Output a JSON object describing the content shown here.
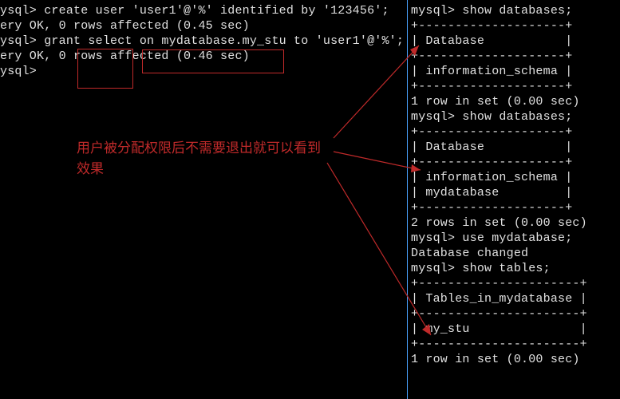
{
  "left": {
    "l1": "ysql> create user 'user1'@'%' identified by '123456';",
    "l2": "ery OK, 0 rows affected (0.45 sec)",
    "l3": "",
    "l4": "ysql> grant select on mydatabase.my_stu to 'user1'@'%';",
    "l5": "ery OK, 0 rows affected (0.46 sec)",
    "l6": "",
    "l7": "ysql>"
  },
  "right": {
    "r1": "mysql> show databases;",
    "r2": "+--------------------+",
    "r3": "| Database           |",
    "r4": "+--------------------+",
    "r5": "| information_schema |",
    "r6": "+--------------------+",
    "r7": "1 row in set (0.00 sec)",
    "r8": "",
    "r9": "mysql> show databases;",
    "r10": "+--------------------+",
    "r11": "| Database           |",
    "r12": "+--------------------+",
    "r13": "| information_schema |",
    "r14": "| mydatabase         |",
    "r15": "+--------------------+",
    "r16": "2 rows in set (0.00 sec)",
    "r17": "",
    "r18": "mysql> use mydatabase;",
    "r19": "Database changed",
    "r20": "mysql> show tables;",
    "r21": "+----------------------+",
    "r22": "| Tables_in_mydatabase |",
    "r23": "+----------------------+",
    "r24": "| my_stu               |",
    "r25": "+----------------------+",
    "r26": "1 row in set (0.00 sec)"
  },
  "annotation": "用户被分配权限后不需要退出就可以看到\n效果",
  "colors": {
    "terminal_fg": "#e0e0e0",
    "terminal_bg": "#000000",
    "divider": "#4aa3ff",
    "annotation_red": "#c02a2a"
  }
}
